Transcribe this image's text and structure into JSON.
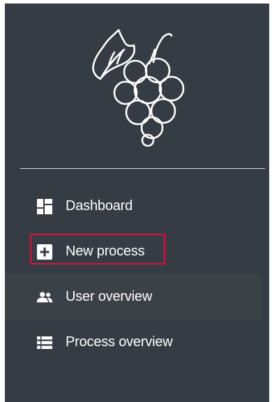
{
  "brand": {
    "logo_icon": "grapes-icon"
  },
  "nav": {
    "items": [
      {
        "id": "dashboard",
        "label": "Dashboard",
        "icon": "dashboard-icon"
      },
      {
        "id": "new-process",
        "label": "New process",
        "icon": "plus-box-icon"
      },
      {
        "id": "user-overview",
        "label": "User overview",
        "icon": "users-icon"
      },
      {
        "id": "process-overview",
        "label": "Process overview",
        "icon": "list-icon"
      }
    ]
  },
  "colors": {
    "sidebar_bg": "#353c43",
    "text": "#ffffff",
    "divider": "#d9dcdf",
    "highlight_border": "#d4163c",
    "hover_bg": "#3a4147"
  }
}
